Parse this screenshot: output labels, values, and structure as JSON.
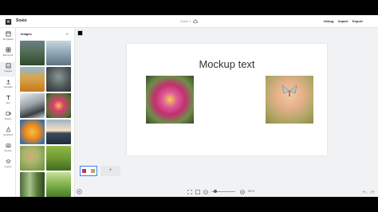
{
  "app": {
    "name": "Sosio",
    "doc_title": "Sosio 1"
  },
  "topbar": {
    "debug": "Debug",
    "import": "Import",
    "export": "Export"
  },
  "rail": [
    {
      "label": "Templates",
      "icon": "template-icon"
    },
    {
      "label": "Elements",
      "icon": "elements-icon"
    },
    {
      "label": "Images",
      "icon": "image-icon"
    },
    {
      "label": "Uploads",
      "icon": "upload-icon"
    },
    {
      "label": "Text",
      "icon": "text-icon"
    },
    {
      "label": "Videos",
      "icon": "video-icon"
    },
    {
      "label": "Graphics",
      "icon": "graphics-icon"
    },
    {
      "label": "Pexels",
      "icon": "pexels-icon"
    },
    {
      "label": "Layers",
      "icon": "layers-icon"
    }
  ],
  "panel": {
    "title": "Images"
  },
  "canvas": {
    "heading": "Mockup text",
    "swatch_color": "#000000"
  },
  "pages": {
    "add_label": "+"
  },
  "zoom": {
    "value": "95 %"
  },
  "colors": {
    "accent": "#3b82f6",
    "bg": "#f1f2f4"
  }
}
